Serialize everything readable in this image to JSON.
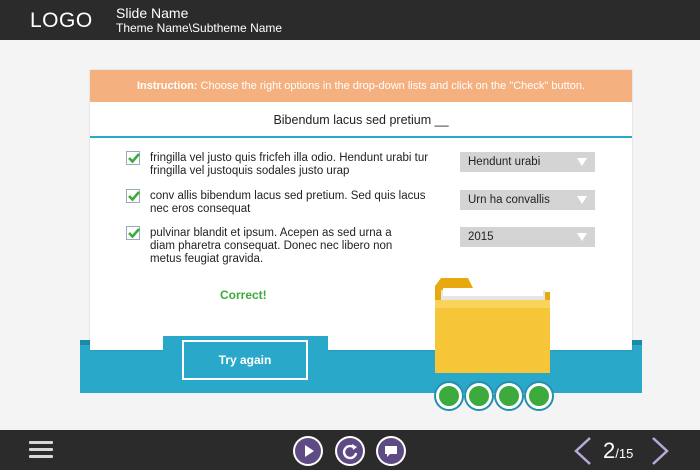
{
  "header": {
    "logo": "LOGO",
    "slide_name": "Slide Name",
    "theme_name": "Theme Name\\Subtheme Name"
  },
  "instruction": {
    "label": "Instruction:",
    "text": "Choose the right options in the drop-down lists and click on the \"Check\" button."
  },
  "question": "Bibendum lacus sed pretium __",
  "items": [
    {
      "text": "fringilla vel justo quis fricfeh illa odio. Hendunt urabi tur fringilla vel justoquis sodales justo urap",
      "checked": true,
      "selected": "Hendunt urabi"
    },
    {
      "text": "conv allis bibendum lacus sed pretium. Sed quis lacus nec eros consequat",
      "checked": true,
      "selected": "Urn ha convallis"
    },
    {
      "text": "pulvinar blandit et ipsum. Acepen as sed urna a diam pharetra consequat. Donec nec libero non metus feugiat gravida.",
      "checked": true,
      "selected": "2015"
    }
  ],
  "feedback": "Correct!",
  "try_again_label": "Try again",
  "progress_dots": 4,
  "footer": {
    "page_current": "2",
    "page_total": "/15"
  },
  "colors": {
    "accent": "#2aa8c9",
    "instruction_bg": "#f5b07f",
    "success": "#3caa3c",
    "bar": "#2b2b2b",
    "control": "#5e4b84"
  }
}
